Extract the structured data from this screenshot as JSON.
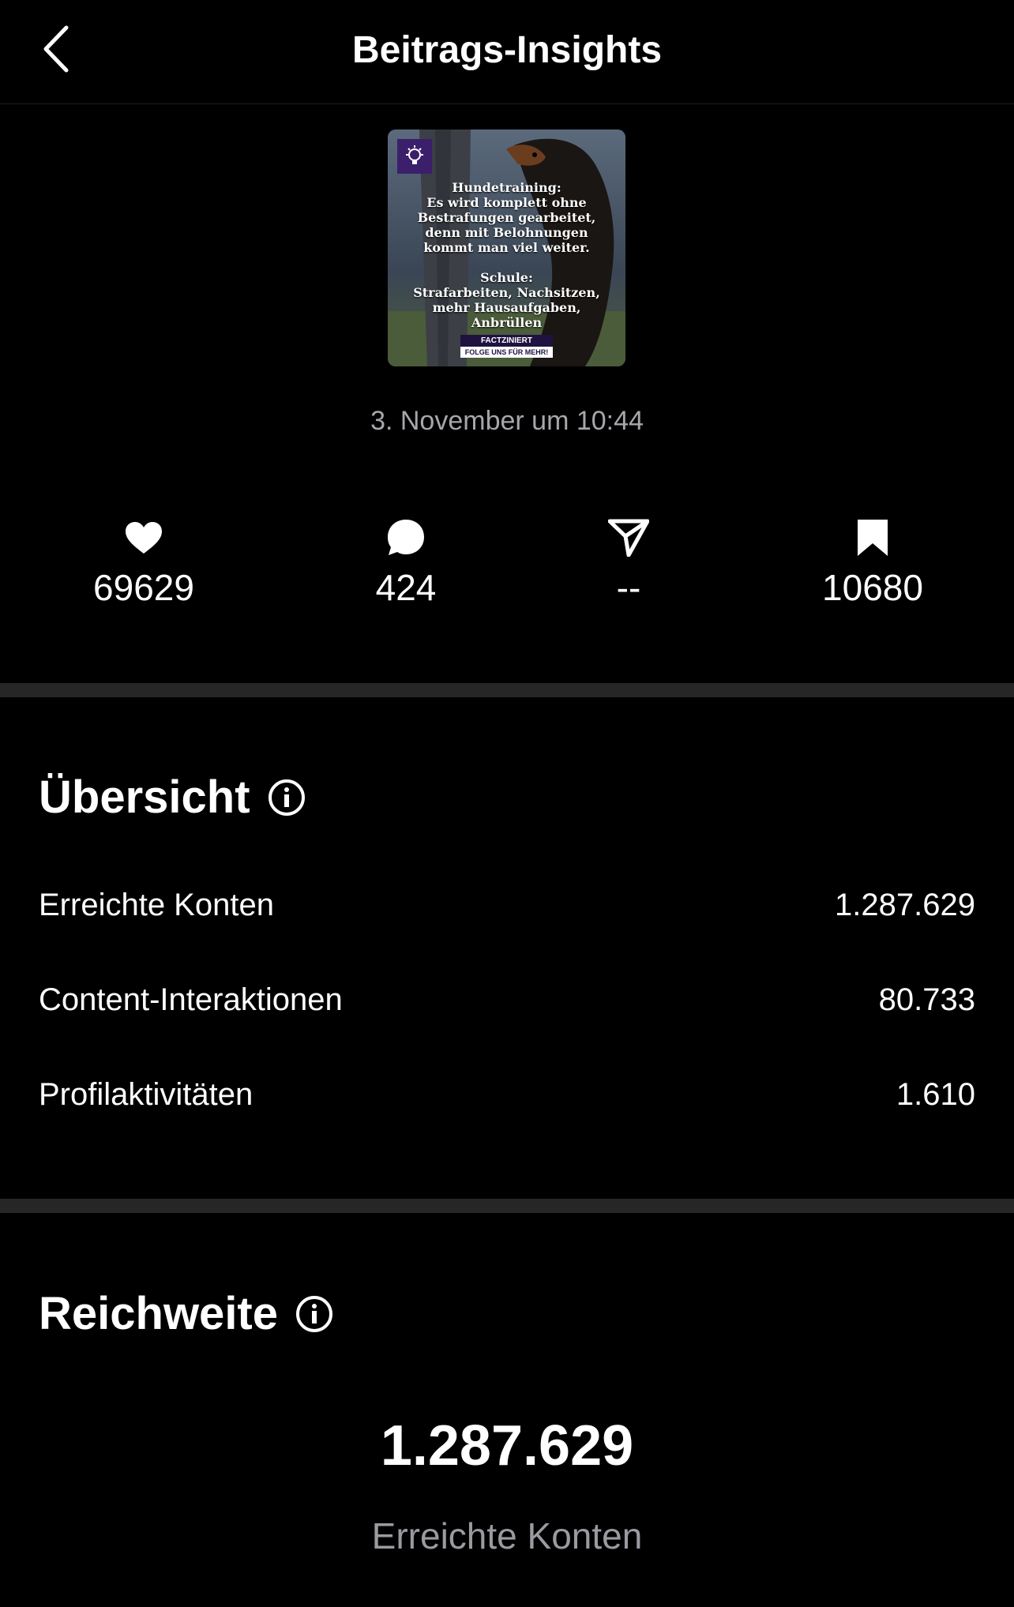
{
  "header": {
    "title": "Beitrags-Insights",
    "back_icon": "chevron-left-icon"
  },
  "post": {
    "date": "3. November um 10:44",
    "thumbnail": {
      "lines_top": [
        "Hundetraining:",
        "Es wird komplett ohne",
        "Bestrafungen gearbeitet,",
        "denn mit Belohnungen",
        "kommt man viel weiter."
      ],
      "lines_bottom": [
        "Schule:",
        "Strafarbeiten, Nachsitzen,",
        "mehr Hausaufgaben, Anbrüllen"
      ],
      "brand": "FACTZINIERT",
      "cta": "FOLGE UNS FÜR MEHR!"
    }
  },
  "metrics": [
    {
      "icon": "heart-icon",
      "value": "69629"
    },
    {
      "icon": "comment-icon",
      "value": "424"
    },
    {
      "icon": "share-icon",
      "value": "--"
    },
    {
      "icon": "bookmark-icon",
      "value": "10680"
    }
  ],
  "overview": {
    "title": "Übersicht",
    "rows": [
      {
        "label": "Erreichte Konten",
        "value": "1.287.629"
      },
      {
        "label": "Content-Interaktionen",
        "value": "80.733"
      },
      {
        "label": "Profilaktivitäten",
        "value": "1.610"
      }
    ]
  },
  "reach": {
    "title": "Reichweite",
    "value": "1.287.629",
    "label": "Erreichte Konten"
  },
  "colors": {
    "background": "#000000",
    "text": "#ffffff",
    "muted": "#a6a6ab",
    "divider": "#262626"
  }
}
